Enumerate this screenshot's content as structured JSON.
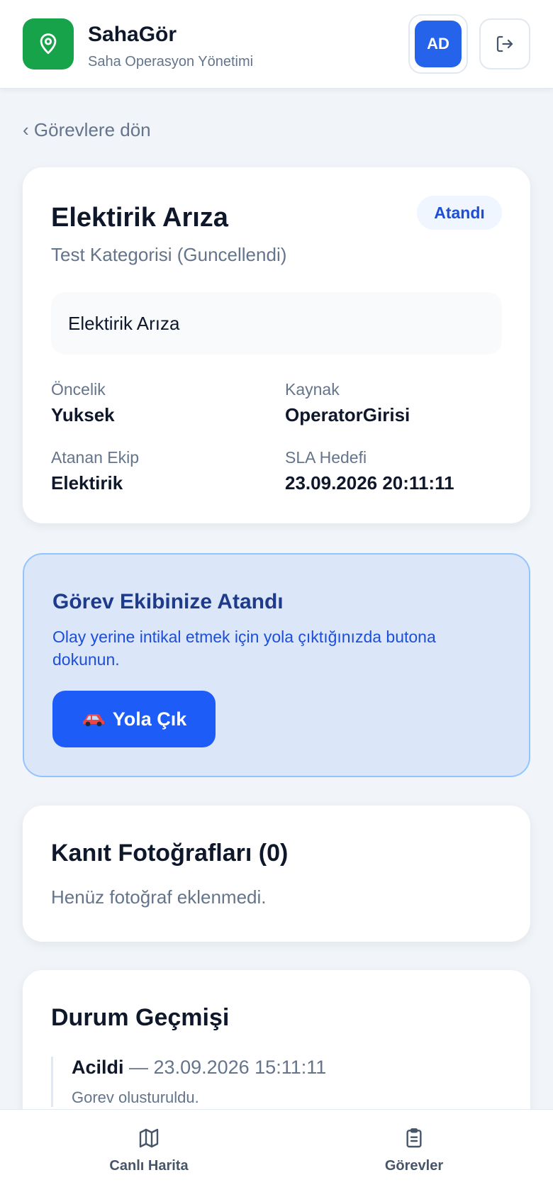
{
  "header": {
    "app_name": "SahaGör",
    "subtitle": "Saha Operasyon Yönetimi",
    "avatar_initials": "AD",
    "logo_icon": "map-pin-icon",
    "logout_icon": "logout-icon"
  },
  "back_link": "‹ Görevlere dön",
  "task": {
    "title": "Elektirik Arıza",
    "status": "Atandı",
    "category": "Test Kategorisi (Guncellendi)",
    "description": "Elektirik Arıza",
    "fields": {
      "priority_label": "Öncelik",
      "priority_value": "Yuksek",
      "source_label": "Kaynak",
      "source_value": "OperatorGirisi",
      "team_label": "Atanan Ekip",
      "team_value": "Elektirik",
      "sla_label": "SLA Hedefi",
      "sla_value": "23.09.2026 20:11:11"
    }
  },
  "assignment": {
    "title": "Görev Ekibinize Atandı",
    "text": "Olay yerine intikal etmek için yola çıktığınızda butona dokunun.",
    "button_label": "Yola Çık",
    "button_icon": "car-icon"
  },
  "photos": {
    "title": "Kanıt Fotoğrafları (0)",
    "empty_text": "Henüz fotoğraf eklenmedi."
  },
  "history": {
    "title": "Durum Geçmişi",
    "items": [
      {
        "status": "Acildi",
        "separator": " — ",
        "timestamp": "23.09.2026 15:11:11",
        "note": "Gorev olusturuldu."
      }
    ]
  },
  "bottom_nav": {
    "items": [
      {
        "label": "Canlı Harita",
        "icon": "map-icon"
      },
      {
        "label": "Görevler",
        "icon": "clipboard-icon"
      }
    ]
  },
  "colors": {
    "brand_green": "#16a34a",
    "accent_blue": "#2563eb",
    "button_blue": "#1d5cf7",
    "assign_bg": "#dbe7f9"
  }
}
